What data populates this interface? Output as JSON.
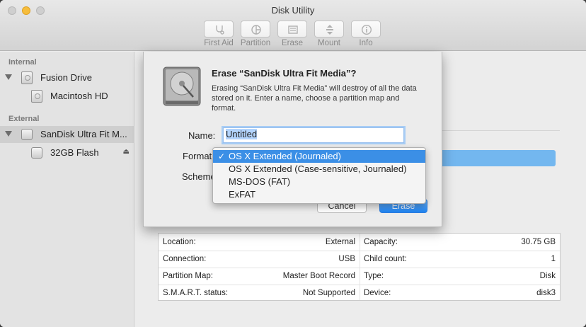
{
  "window": {
    "title": "Disk Utility"
  },
  "toolbar": [
    {
      "label": "First Aid",
      "icon": "stethoscope-icon"
    },
    {
      "label": "Partition",
      "icon": "pie-partition-icon"
    },
    {
      "label": "Erase",
      "icon": "erase-disk-icon"
    },
    {
      "label": "Mount",
      "icon": "mount-icon"
    },
    {
      "label": "Info",
      "icon": "info-icon"
    }
  ],
  "sidebar": {
    "internal_header": "Internal",
    "external_header": "External",
    "items": [
      {
        "label": "Fusion Drive"
      },
      {
        "label": "Macintosh HD"
      },
      {
        "label": "SanDisk Ultra Fit M..."
      },
      {
        "label": "32GB Flash"
      }
    ],
    "eject_glyph": "⏏"
  },
  "sheet": {
    "title": "Erase “SanDisk Ultra Fit Media”?",
    "description": "Erasing “SanDisk Ultra Fit Media” will destroy of all the data stored on it. Enter a name, choose a partition map and format.",
    "name_label": "Name:",
    "name_value": "Untitled",
    "format_label": "Format",
    "scheme_label": "Scheme",
    "cancel_label": "Cancel",
    "erase_label": "Erase"
  },
  "format_menu": {
    "check_glyph": "✓",
    "options": [
      {
        "label": "OS X Extended (Journaled)",
        "selected": true
      },
      {
        "label": "OS X Extended (Case-sensitive, Journaled)",
        "selected": false
      },
      {
        "label": "MS-DOS (FAT)",
        "selected": false
      },
      {
        "label": "ExFAT",
        "selected": false
      }
    ]
  },
  "info_table": {
    "left": [
      {
        "key": "Location:",
        "value": "External"
      },
      {
        "key": "Connection:",
        "value": "USB"
      },
      {
        "key": "Partition Map:",
        "value": "Master Boot Record"
      },
      {
        "key": "S.M.A.R.T. status:",
        "value": "Not Supported"
      }
    ],
    "right": [
      {
        "key": "Capacity:",
        "value": "30.75 GB"
      },
      {
        "key": "Child count:",
        "value": "1"
      },
      {
        "key": "Type:",
        "value": "Disk"
      },
      {
        "key": "Device:",
        "value": "disk3"
      }
    ]
  },
  "colors": {
    "accent": "#3b8fe6",
    "usage_bar": "#73b7ef",
    "minimize": "#f6bd3c"
  }
}
